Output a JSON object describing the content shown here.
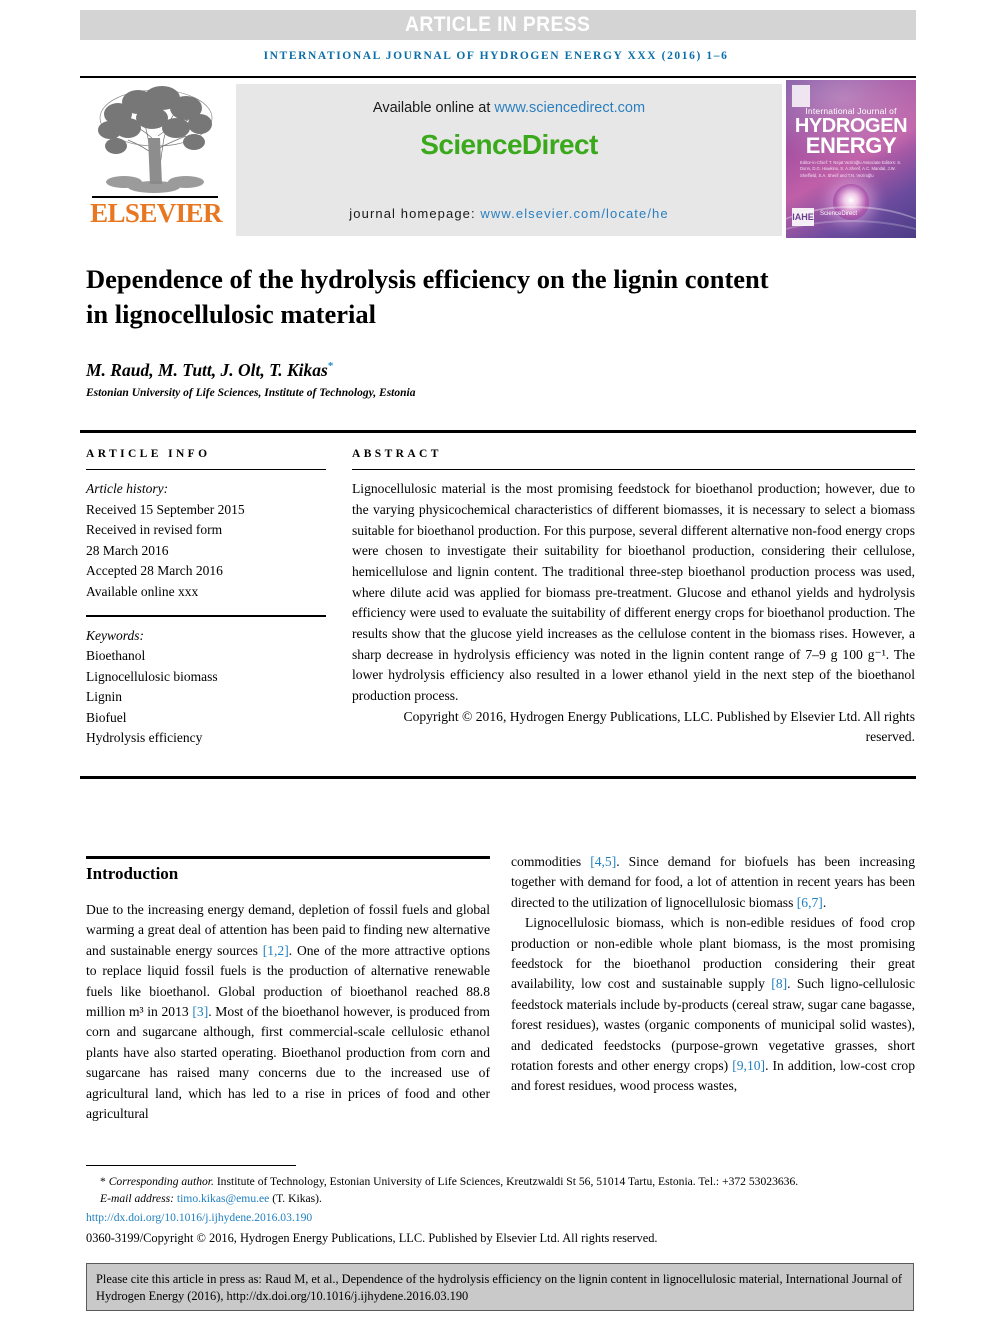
{
  "banner": {
    "text": "ARTICLE IN PRESS"
  },
  "running_head": {
    "text": "INTERNATIONAL JOURNAL OF HYDROGEN ENERGY XXX (2016) 1–6"
  },
  "masthead": {
    "publisher_name": "ELSEVIER",
    "available_online_prefix": "Available online at ",
    "sciencedirect_url": "www.sciencedirect.com",
    "sciencedirect_logo": "ScienceDirect",
    "homepage_prefix": "journal homepage: ",
    "homepage_url": "www.elsevier.com/locate/he",
    "cover": {
      "line1": "International Journal of",
      "line2": "HYDROGEN",
      "line3": "ENERGY",
      "editors": "Editor-in-Chief: T. Nejat Veziroğlu   Associate Editors: S. Dunn, D.G. Hawkins, S. A.Sherif, A.C. Mandal, J.W. Sheffield, S.A. Sherif and T.N. Veziroğlu",
      "imprint": "IAHE",
      "sciencedirect_mini": "ScienceDirect"
    }
  },
  "article": {
    "title": "Dependence of the hydrolysis efficiency on the lignin content in lignocellulosic material",
    "authors": "M. Raud, M. Tutt, J. Olt, T. Kikas",
    "corresponding_marker": "*",
    "affiliation": "Estonian University of Life Sciences, Institute of Technology, Estonia"
  },
  "info": {
    "heading": "ARTICLE INFO",
    "history_label": "Article history:",
    "history": [
      "Received 15 September 2015",
      "Received in revised form",
      "28 March 2016",
      "Accepted 28 March 2016",
      "Available online xxx"
    ],
    "keywords_label": "Keywords:",
    "keywords": [
      "Bioethanol",
      "Lignocellulosic biomass",
      "Lignin",
      "Biofuel",
      "Hydrolysis efficiency"
    ]
  },
  "abstract": {
    "heading": "ABSTRACT",
    "text": "Lignocellulosic material is the most promising feedstock for bioethanol production; however, due to the varying physicochemical characteristics of different biomasses, it is necessary to select a biomass suitable for bioethanol production. For this purpose, several different alternative non-food energy crops were chosen to investigate their suitability for bioethanol production, considering their cellulose, hemicellulose and lignin content. The traditional three-step bioethanol production process was used, where dilute acid was applied for biomass pre-treatment. Glucose and ethanol yields and hydrolysis efficiency were used to evaluate the suitability of different energy crops for bioethanol production. The results show that the glucose yield increases as the cellulose content in the biomass rises. However, a sharp decrease in hydrolysis efficiency was noted in the lignin content range of 7–9 g 100 g⁻¹. The lower hydrolysis efficiency also resulted in a lower ethanol yield in the next step of the bioethanol production process.",
    "copyright": "Copyright © 2016, Hydrogen Energy Publications, LLC. Published by Elsevier Ltd. All rights reserved."
  },
  "introduction": {
    "heading": "Introduction",
    "left_paragraph_1": "Due to the increasing energy demand, depletion of fossil fuels and global warming a great deal of attention has been paid to finding new alternative and sustainable energy sources ",
    "left_ref_1": "[1,2]",
    "left_paragraph_1b": ". One of the more attractive options to replace liquid fossil fuels is the production of alternative renewable fuels like bioethanol. Global production of bioethanol reached 88.8 million m³ in 2013 ",
    "left_ref_2": "[3]",
    "left_paragraph_1c": ". Most of the bioethanol however, is produced from corn and sugarcane although, first commercial-scale cellulosic ethanol plants have also started operating. Bioethanol production from corn and sugarcane has raised many concerns due to the increased use of agricultural land, which has led to a rise in prices of food and other agricultural",
    "right_paragraph_1": "commodities ",
    "right_ref_1": "[4,5]",
    "right_paragraph_1b": ". Since demand for biofuels has been increasing together with demand for food, a lot of attention in recent years has been directed to the utilization of lignocellulosic biomass ",
    "right_ref_2": "[6,7]",
    "right_paragraph_1c": ".",
    "right_paragraph_2": "Lignocellulosic biomass, which is non-edible residues of food crop production or non-edible whole plant biomass, is the most promising feedstock for the bioethanol production considering their great availability, low cost and sustainable supply ",
    "right_ref_3": "[8]",
    "right_paragraph_2b": ". Such ligno-cellulosic feedstock materials include by-products (cereal straw, sugar cane bagasse, forest residues), wastes (organic components of municipal solid wastes), and dedicated feedstocks (purpose-grown vegetative grasses, short rotation forests and other energy crops) ",
    "right_ref_4": "[9,10]",
    "right_paragraph_2c": ". In addition, low-cost crop and forest residues, wood process wastes,"
  },
  "footnotes": {
    "corresponding_star": "*",
    "corresponding_label": "Corresponding author.",
    "corresponding_text": " Institute of Technology, Estonian University of Life Sciences, Kreutzwaldi St 56, 51014 Tartu, Estonia. Tel.: +372 53023636.",
    "email_label": "E-mail address: ",
    "email_address": "timo.kikas@emu.ee",
    "email_suffix": " (T. Kikas).",
    "doi": "http://dx.doi.org/10.1016/j.ijhydene.2016.03.190",
    "copyright": "0360-3199/Copyright © 2016, Hydrogen Energy Publications, LLC. Published by Elsevier Ltd. All rights reserved."
  },
  "cite_box": {
    "text": "Please cite this article in press as: Raud M, et al., Dependence of the hydrolysis efficiency on the lignin content in lignocellulosic material, International Journal of Hydrogen Energy (2016), http://dx.doi.org/10.1016/j.ijhydene.2016.03.190"
  },
  "colors": {
    "link": "#2b7fbf",
    "reference": "#1f7fbf",
    "sciencedirect_green": "#3aa91b",
    "elsevier_orange": "#e87722",
    "runhead_blue": "#0b6ea8",
    "banner_gray": "#d4d4d4",
    "cite_box_gray": "#c9c9c9"
  }
}
